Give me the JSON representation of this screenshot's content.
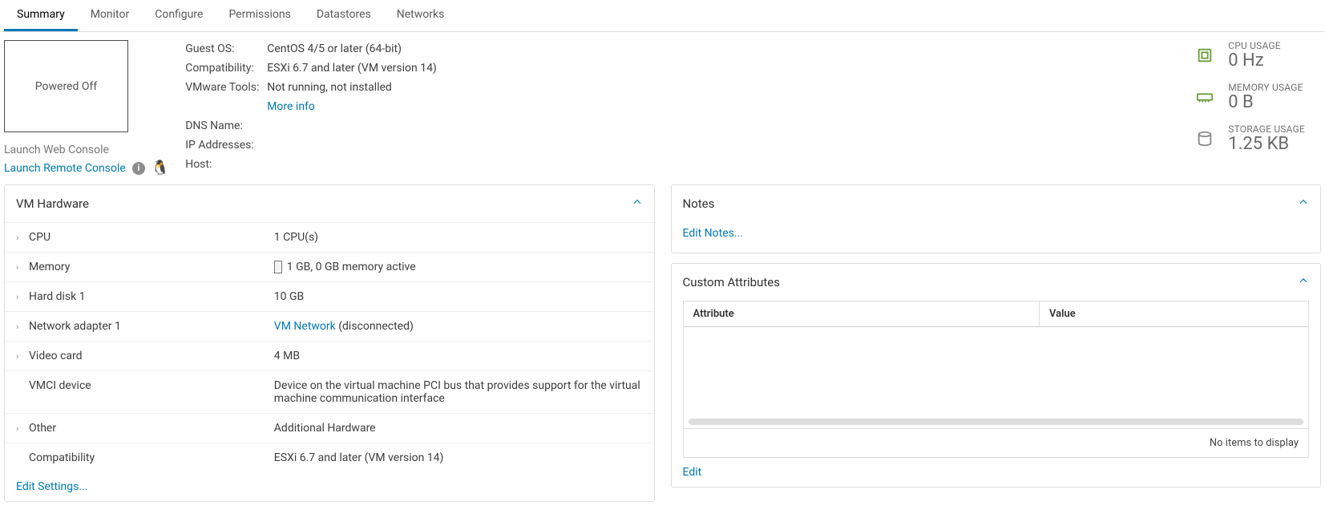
{
  "tabs": {
    "summary": "Summary",
    "monitor": "Monitor",
    "configure": "Configure",
    "permissions": "Permissions",
    "datastores": "Datastores",
    "networks": "Networks"
  },
  "thumbnail": {
    "status": "Powered Off",
    "launch_web": "Launch Web Console",
    "launch_remote": "Launch Remote Console"
  },
  "info": {
    "guest_os_label": "Guest OS:",
    "guest_os_value": "CentOS 4/5 or later (64-bit)",
    "compat_label": "Compatibility:",
    "compat_value": "ESXi 6.7 and later (VM version 14)",
    "tools_label": "VMware Tools:",
    "tools_value": "Not running, not installed",
    "more_info": "More info",
    "dns_label": "DNS Name:",
    "dns_value": "",
    "ip_label": "IP Addresses:",
    "ip_value": "",
    "host_label": "Host:",
    "host_value": ""
  },
  "usage": {
    "cpu_label": "CPU USAGE",
    "cpu_value": "0 Hz",
    "mem_label": "MEMORY USAGE",
    "mem_value": "0 B",
    "storage_label": "STORAGE USAGE",
    "storage_value": "1.25 KB"
  },
  "hardware": {
    "title": "VM Hardware",
    "rows": {
      "cpu_label": "CPU",
      "cpu_value": "1 CPU(s)",
      "mem_label": "Memory",
      "mem_value": "1 GB, 0 GB memory active",
      "hd_label": "Hard disk 1",
      "hd_value": "10 GB",
      "net_label": "Network adapter 1",
      "net_link": "VM Network",
      "net_suffix": " (disconnected)",
      "video_label": "Video card",
      "video_value": "4 MB",
      "vmci_label": "VMCI device",
      "vmci_value": "Device on the virtual machine PCI bus that provides support for the virtual machine communication interface",
      "other_label": "Other",
      "other_value": "Additional Hardware",
      "compat_label": "Compatibility",
      "compat_value": "ESXi 6.7 and later (VM version 14)"
    },
    "edit": "Edit Settings..."
  },
  "notes": {
    "title": "Notes",
    "edit": "Edit Notes..."
  },
  "attributes": {
    "title": "Custom Attributes",
    "col_attr": "Attribute",
    "col_value": "Value",
    "no_items": "No items to display",
    "edit": "Edit"
  }
}
